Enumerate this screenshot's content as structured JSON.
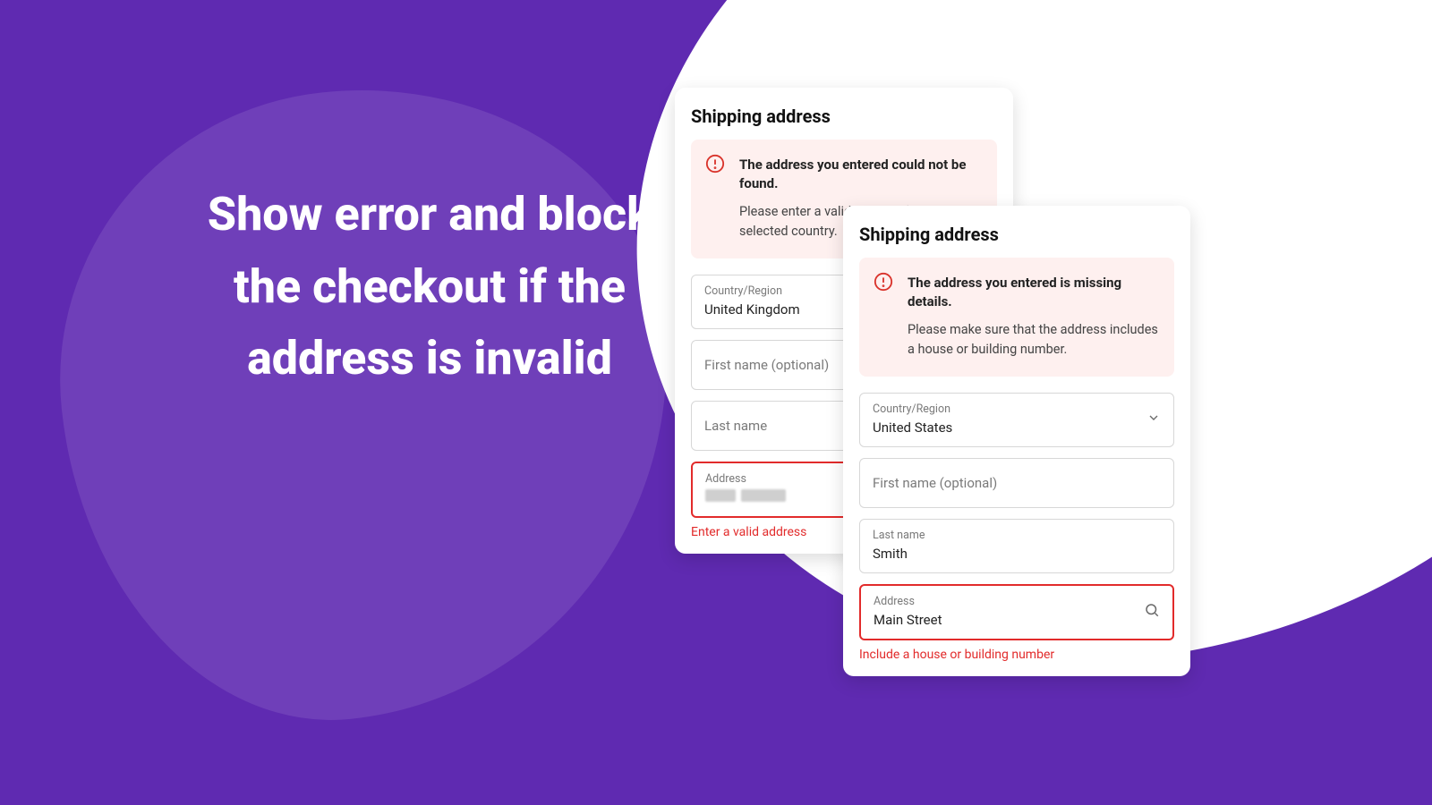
{
  "hero": {
    "text": "Show error and block the checkout if the address is invalid"
  },
  "card_a": {
    "title": "Shipping address",
    "alert": {
      "title": "The address you entered could not be found.",
      "body": "Please enter a valid address for the selected country."
    },
    "country": {
      "label": "Country/Region",
      "value": "United Kingdom"
    },
    "first_name": {
      "placeholder": "First name (optional)"
    },
    "last_name": {
      "placeholder": "Last name"
    },
    "address": {
      "label": "Address",
      "error": "Enter a valid address"
    }
  },
  "card_b": {
    "title": "Shipping address",
    "alert": {
      "title": "The address you entered is missing details.",
      "body": "Please make sure that the address includes a house or building number."
    },
    "country": {
      "label": "Country/Region",
      "value": "United States"
    },
    "first_name": {
      "placeholder": "First name (optional)"
    },
    "last_name": {
      "label": "Last name",
      "value": "Smith"
    },
    "address": {
      "label": "Address",
      "value": "Main Street",
      "error": "Include a house or building number"
    }
  }
}
